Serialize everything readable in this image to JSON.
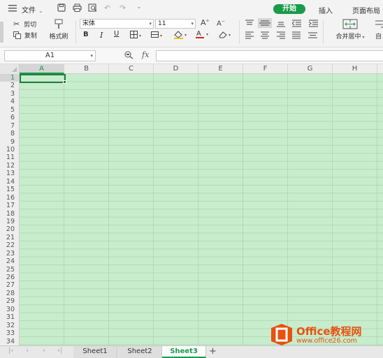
{
  "menubar": {
    "file_label": "文件",
    "tabs": [
      {
        "label": "开始",
        "active": true
      },
      {
        "label": "插入",
        "active": false
      },
      {
        "label": "页面布局",
        "active": false
      }
    ]
  },
  "ribbon": {
    "cut_label": "剪切",
    "copy_label": "复制",
    "format_painter_label": "格式刷",
    "font_name": "宋体",
    "font_size": "11",
    "merge_center_label": "合并居中",
    "auto_wrap_label": "自"
  },
  "formula_bar": {
    "cell_ref": "A1",
    "fx_label": "fx",
    "formula": ""
  },
  "sheet": {
    "columns": [
      "A",
      "B",
      "C",
      "D",
      "E",
      "F",
      "G",
      "H"
    ],
    "rows": [
      "1",
      "2",
      "3",
      "4",
      "5",
      "6",
      "7",
      "8",
      "9",
      "10",
      "11",
      "12",
      "13",
      "14",
      "15",
      "16",
      "17",
      "18",
      "19",
      "20",
      "21",
      "22",
      "23",
      "24",
      "25",
      "26",
      "27",
      "28",
      "29",
      "30",
      "31",
      "32",
      "33",
      "34"
    ],
    "selected_cell": "A1",
    "cell_fill_color": "#c7edcc"
  },
  "sheet_tabs": [
    {
      "label": "Sheet1",
      "active": false
    },
    {
      "label": "Sheet2",
      "active": false
    },
    {
      "label": "Sheet3",
      "active": true
    }
  ],
  "watermark": {
    "brand": "Office教程网",
    "url": "www.office26.com"
  },
  "colors": {
    "accent": "#1a9b4a",
    "brand_orange": "#e8510f"
  }
}
